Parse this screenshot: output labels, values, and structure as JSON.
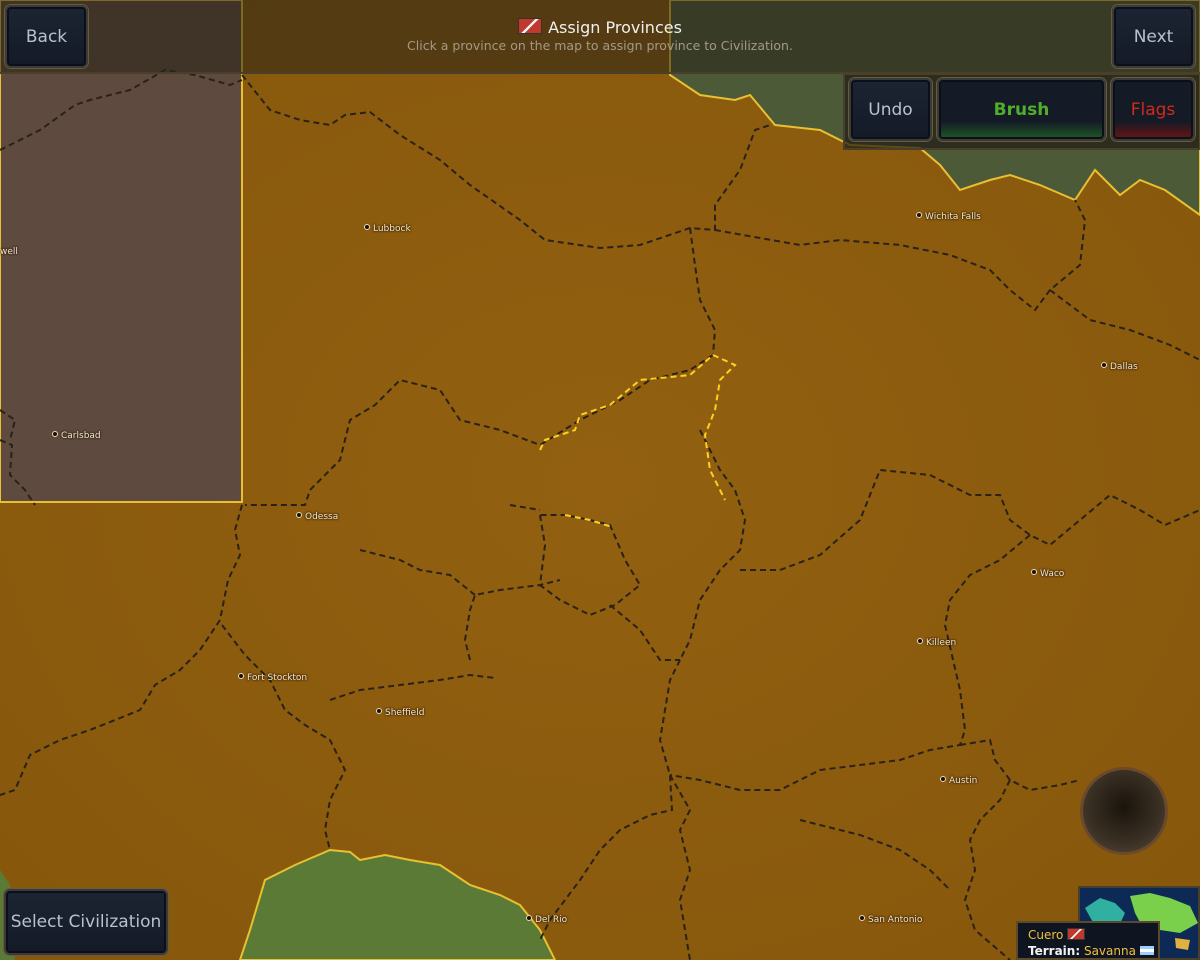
{
  "header": {
    "title": "Assign Provinces",
    "subtitle": "Click a province on the map to assign province to Civilization."
  },
  "buttons": {
    "back": "Back",
    "next": "Next",
    "undo": "Undo",
    "brush": "Brush",
    "flags": "Flags",
    "select_civ": "Select Civilization"
  },
  "colors": {
    "land": "#8e5d0d",
    "other_civ": "#5e4a3e",
    "green": "#5b7a36",
    "brush_accent": "#3f9a2a",
    "flags_accent": "#d12a1a",
    "province_border": "#2a2216",
    "selection": "#ffd020"
  },
  "cities": [
    {
      "name": "Lubbock"
    },
    {
      "name": "Wichita Falls"
    },
    {
      "name": "well"
    },
    {
      "name": "Dallas"
    },
    {
      "name": "Carlsbad"
    },
    {
      "name": "Odessa"
    },
    {
      "name": "Waco"
    },
    {
      "name": "Killeen"
    },
    {
      "name": "Fort Stockton"
    },
    {
      "name": "Sheffield"
    },
    {
      "name": "Austin"
    },
    {
      "name": "Del Rio"
    },
    {
      "name": "San Antonio"
    }
  ],
  "info": {
    "province": "Cuero",
    "terrain_label": "Terrain:",
    "terrain_value": "Savanna"
  }
}
